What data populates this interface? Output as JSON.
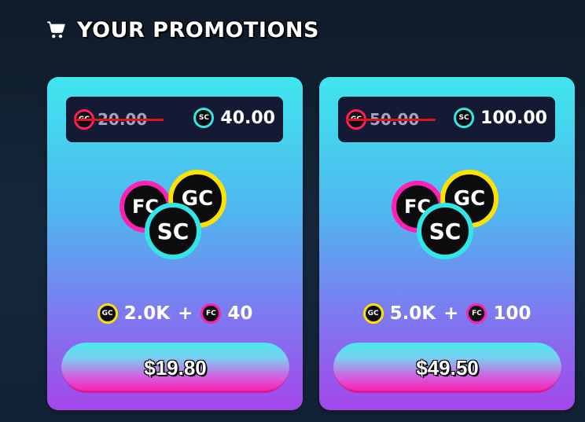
{
  "header": {
    "title": "YOUR PROMOTIONS",
    "icon": "shopping-cart-icon"
  },
  "promotions": [
    {
      "old_price": "20.00",
      "old_price_badge": "GC",
      "new_price": "40.00",
      "new_price_badge": "SC",
      "gc_amount": "2.0K",
      "fc_amount": "40",
      "buy_label": "$19.80"
    },
    {
      "old_price": "50.00",
      "old_price_badge": "GC",
      "new_price": "100.00",
      "new_price_badge": "SC",
      "gc_amount": "5.0K",
      "fc_amount": "100",
      "buy_label": "$49.50"
    }
  ],
  "labels": {
    "plus": "+",
    "gc": "GC",
    "sc": "SC",
    "fc": "FC"
  },
  "colors": {
    "gc": "#ffe100",
    "sc": "#33e6e6",
    "fc": "#ff1fb2",
    "strike": "#e0141d"
  }
}
